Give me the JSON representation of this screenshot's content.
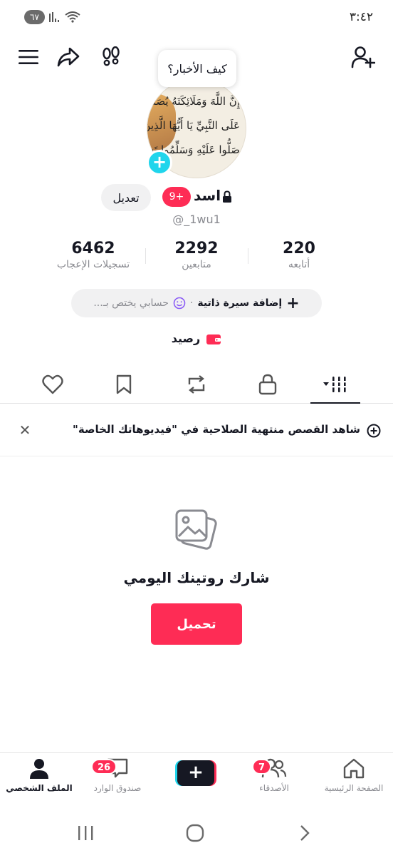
{
  "status_bar": {
    "time": "٣:٤٢",
    "battery": "٦٧"
  },
  "tooltip": {
    "text": "كيف الأخبار؟"
  },
  "avatar": {
    "lines": [
      "إِنَّ اللَّهَ وَمَلَائِكَتَهُ يُصَلُّونَ",
      "عَلَى النَّبِيِّ يَا أَيُّهَا الَّذِينَ آمَنُوا",
      "صَلُّوا عَلَيْهِ وَسَلِّمُوا تَسْلِيمًا"
    ]
  },
  "profile": {
    "name": "اسد",
    "badge": "9+",
    "edit_label": "تعديل",
    "username": "@_1wu1"
  },
  "stats": [
    {
      "value": "6462",
      "label": "تسجيلات الإعجاب"
    },
    {
      "value": "2292",
      "label": "متابعين"
    },
    {
      "value": "220",
      "label": "أتابعه"
    }
  ],
  "bio": {
    "add_label": "إضافة سيرة ذاتية",
    "separator": "·",
    "placeholder": "حسابي يختص بـ..."
  },
  "balance": {
    "label": "رصيد"
  },
  "notice": {
    "text": "شاهد القصص منتهية الصلاحية في \"فيديوهاتك الخاصة\""
  },
  "empty_state": {
    "title": "شارك روتينك اليومي",
    "upload_label": "تحميل"
  },
  "bottom_nav": {
    "home": "الصفحة الرئيسية",
    "friends": "الأصدقاء",
    "friends_badge": "7",
    "inbox": "صندوق الوارد",
    "inbox_badge": "26",
    "profile": "الملف الشخصي"
  },
  "colors": {
    "accent": "#fe2c55",
    "cyan": "#20d5ec",
    "text": "#161823",
    "muted": "#8a8b91"
  }
}
